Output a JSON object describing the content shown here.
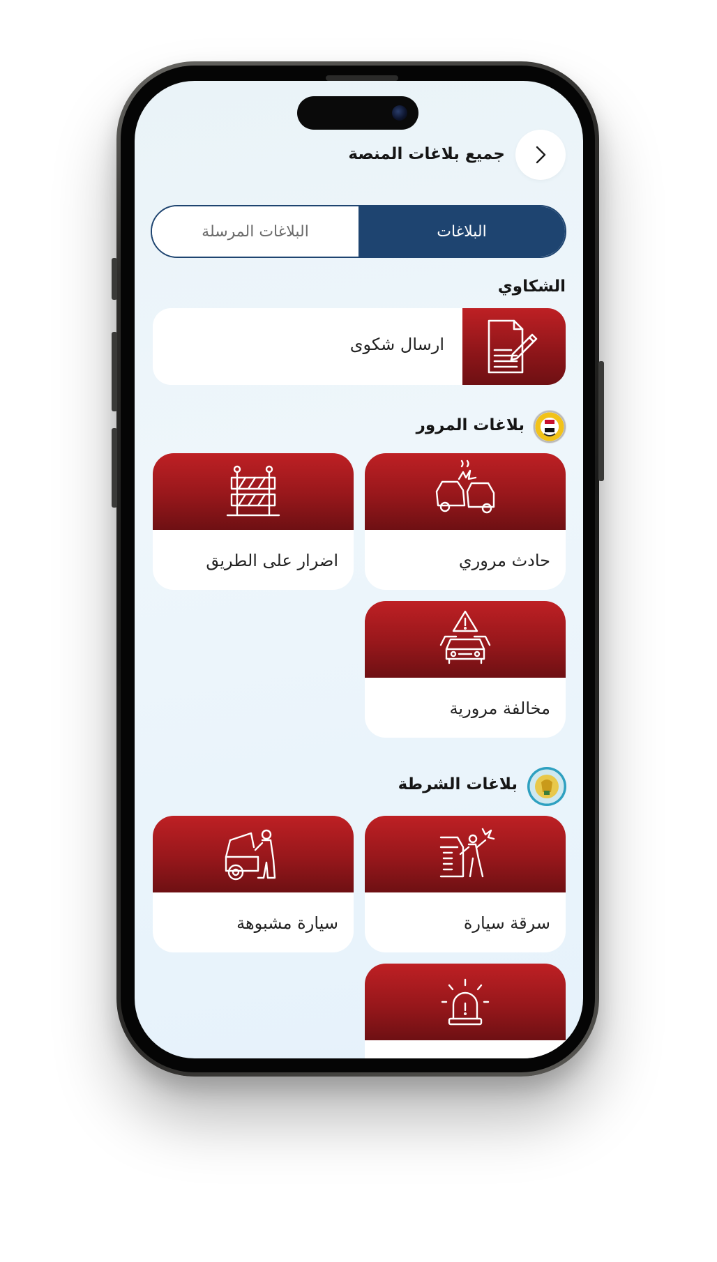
{
  "header": {
    "title": "جميع بلاغات المنصة"
  },
  "tabs": [
    {
      "label": "البلاغات",
      "active": true
    },
    {
      "label": "البلاغات المرسلة",
      "active": false
    }
  ],
  "complaints": {
    "title": "الشكاوي",
    "card": {
      "label": "ارسال شكوى",
      "icon": "document-edit-icon"
    }
  },
  "traffic": {
    "title": "بلاغات المرور",
    "logo_icon": "traffic-directorate-logo",
    "items": [
      {
        "label": "حادث مروري",
        "icon": "car-crash-icon"
      },
      {
        "label": "اضرار على الطريق",
        "icon": "road-barrier-icon"
      },
      {
        "label": "مخالفة مرورية",
        "icon": "traffic-violation-icon"
      }
    ]
  },
  "police": {
    "title": "بلاغات الشرطة",
    "logo_icon": "police-logo",
    "items": [
      {
        "label": "سرقة سيارة",
        "icon": "car-theft-icon"
      },
      {
        "label": "سيارة مشبوهة",
        "icon": "suspicious-car-icon"
      },
      {
        "label": "",
        "icon": "alarm-siren-icon"
      }
    ]
  },
  "colors": {
    "primary": "#1e4470",
    "accent_red": "#be2024",
    "accent_red_dark": "#6e1013",
    "background": "#eaf3f8"
  }
}
